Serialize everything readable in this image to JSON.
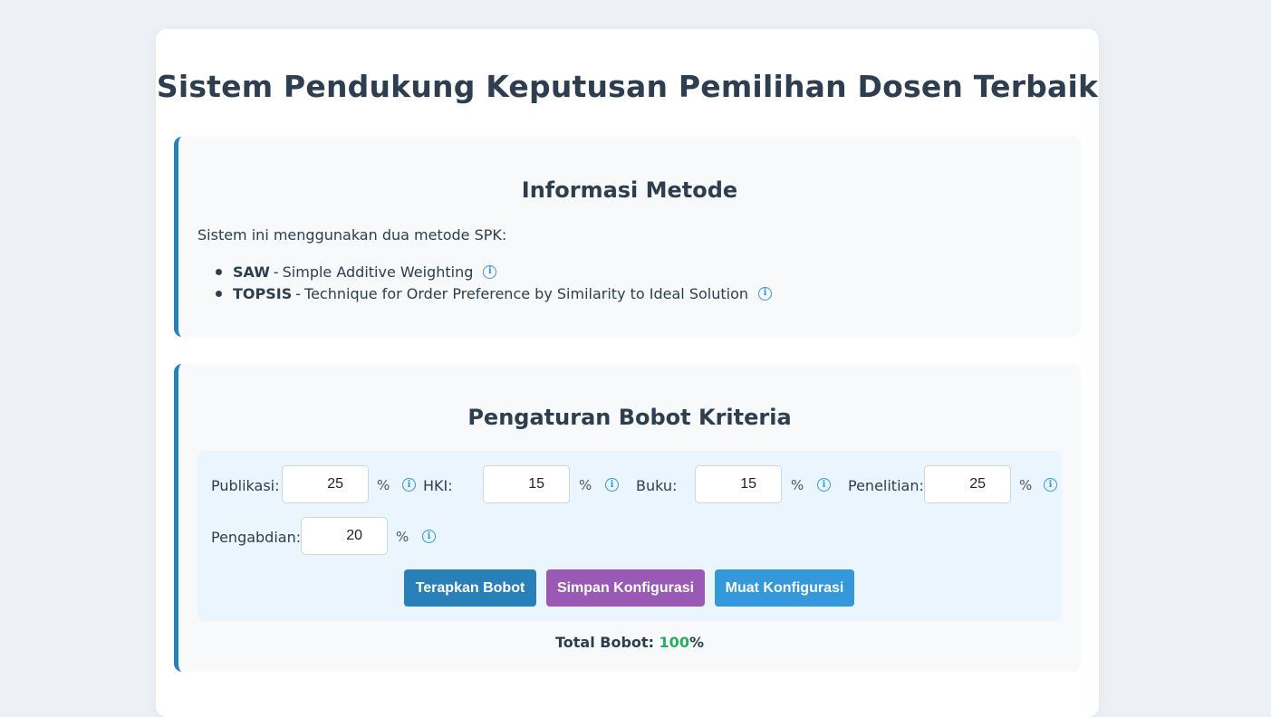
{
  "page": {
    "title": "Sistem Pendukung Keputusan Pemilihan Dosen Terbaik"
  },
  "method_info": {
    "title": "Informasi Metode",
    "intro": "Sistem ini menggunakan dua metode SPK:",
    "methods": [
      {
        "name": "SAW",
        "separator": "-",
        "description": "Simple Additive Weighting",
        "icon": "info-icon"
      },
      {
        "name": "TOPSIS",
        "separator": "-",
        "description": "Technique for Order Preference by Similarity to Ideal Solution",
        "icon": "info-icon"
      }
    ]
  },
  "weights": {
    "title": "Pengaturan Bobot Kriteria",
    "criteria": [
      {
        "label": "Publikasi:",
        "value": "25",
        "unit": "%"
      },
      {
        "label": "HKI:",
        "value": "15",
        "unit": "%"
      },
      {
        "label": "Buku:",
        "value": "15",
        "unit": "%"
      },
      {
        "label": "Penelitian:",
        "value": "25",
        "unit": "%"
      },
      {
        "label": "Pengabdian:",
        "value": "20",
        "unit": "%"
      }
    ],
    "buttons": {
      "apply": "Terapkan Bobot",
      "save": "Simpan Konfigurasi",
      "load": "Muat Konfigurasi"
    },
    "total": {
      "label": "Total Bobot:",
      "value": "100",
      "unit": "%"
    }
  },
  "colors": {
    "accent_border": "#2980b9",
    "apply_button": "#2980b9",
    "save_button": "#9b59b6",
    "load_button": "#3498db",
    "total_value": "#27ae60",
    "info_icon": "#3498db"
  }
}
